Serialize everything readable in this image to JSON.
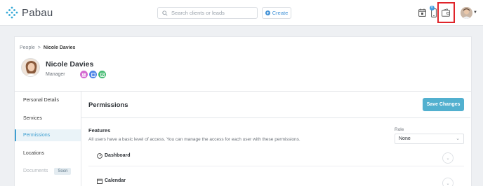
{
  "app": {
    "name": "Pabau",
    "brand_color": "#3f9fd1"
  },
  "header": {
    "search_placeholder": "Search clients or leads",
    "create_label": "Create",
    "notification_count": "0",
    "icons": [
      "calendar-icon",
      "mobile-icon",
      "wallet-icon",
      "avatar",
      "chevron-down-icon"
    ],
    "highlight_color": "#e0242a"
  },
  "breadcrumb": {
    "root": "People",
    "separator": ">",
    "current": "Nicole Davies"
  },
  "profile": {
    "name": "Nicole Davies",
    "role": "Manager",
    "role_badges": [
      {
        "icon": "group-icon",
        "color": "#d46ad0"
      },
      {
        "icon": "square-icon",
        "color": "#4c84e6"
      },
      {
        "icon": "check-icon",
        "color": "#46bb73"
      }
    ]
  },
  "sidebar": {
    "items": [
      {
        "label": "Personal Details",
        "state": "normal"
      },
      {
        "label": "Services",
        "state": "normal"
      },
      {
        "label": "Permissions",
        "state": "active"
      },
      {
        "label": "Locations",
        "state": "normal"
      },
      {
        "label": "Documents",
        "state": "disabled",
        "badge": "Soon"
      }
    ]
  },
  "permissions": {
    "title": "Permissions",
    "save_label": "Save Changes",
    "features_title": "Features",
    "features_desc": "All users have a basic level of access. You can manage the access for each user with these permissions.",
    "role_label": "Role",
    "role_value": "None",
    "features": [
      {
        "label": "Dashboard",
        "icon": "dashboard-icon"
      },
      {
        "label": "Calendar",
        "icon": "calendar-icon"
      }
    ]
  }
}
